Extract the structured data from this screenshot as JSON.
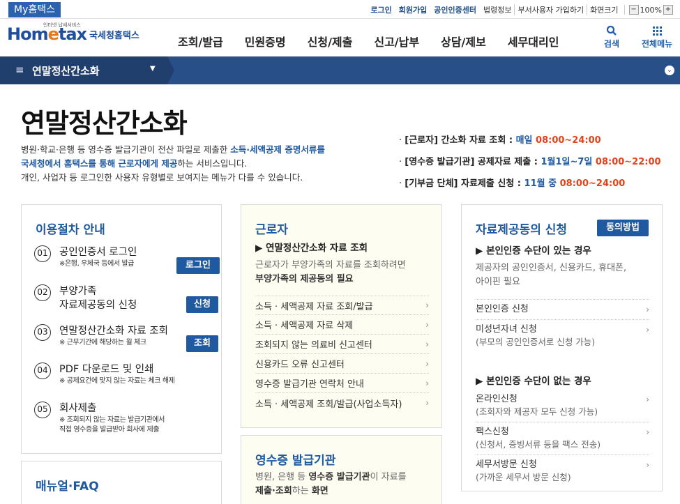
{
  "topbar": {
    "myhome": "My홈택스",
    "login": "로그인",
    "join": "회원가입",
    "cert": "공인인증센터",
    "law": "법령정보",
    "dept": "부서사용자 가입하기",
    "zoom_label": "화면크기",
    "zoom_minus": "−",
    "zoom_value": "100%",
    "zoom_plus": "+"
  },
  "header": {
    "logo_small": "인터넷 납세서비스",
    "logo_home": "Hom",
    "logo_e": "e",
    "logo_tax": "tax",
    "logo_text": "국세청홈택스",
    "nav": [
      "조회/발급",
      "민원증명",
      "신청/제출",
      "신고/납부",
      "상담/제보",
      "세무대리인"
    ],
    "search": "검색",
    "all_menu": "전체메뉴",
    "icons": {
      "search": "search-icon",
      "menu": "grid-menu-icon"
    }
  },
  "subbar": {
    "title": "연말정산간소화",
    "hamburger": "≡",
    "caret": "▼",
    "circle": "⌄"
  },
  "page": {
    "title": "연말정산간소화",
    "intro_1a": "병원·학교·은행 등 영수증 발급기관이 전산 파일로 제출한 ",
    "intro_1b": "소득·세액공제 증명서류를",
    "intro_2a": "국세청에서 홈택스를 통해 근로자에게 제공",
    "intro_2b": "하는 서비스입니다.",
    "intro_3": "개인, 사업자 등 로그인한 사용자 유형별로 보여지는 메뉴가 다를 수 있습니다.",
    "schedule": [
      {
        "label": "[근로자] 간소화 자료 조회 : ",
        "period": "매일 ",
        "time": "08:00~24:00"
      },
      {
        "label": "[영수증 발급기관] 공제자료 제출 : ",
        "period": "1월1일~7일 ",
        "time": "08:00~22:00"
      },
      {
        "label": "[기부금 단체] 자료제출 신청 : ",
        "period": "11월 중 ",
        "time": "08:00~24:00"
      }
    ]
  },
  "guide": {
    "title": "이용절차 안내",
    "steps": [
      {
        "num": "01",
        "title": "공인인증서 로그인",
        "note": "※은행, 우체국 등에서 발급",
        "button": "로그인"
      },
      {
        "num": "02",
        "title": "부양가족",
        "title2": "자료제공동의 신청",
        "button": "신청"
      },
      {
        "num": "03",
        "title": "연말정산간소화 자료 조회",
        "note": "※ 근무기간에 해당하는 월 체크",
        "button": "조회"
      },
      {
        "num": "04",
        "title": "PDF 다운로드 및 인쇄",
        "note": "※ 공제요건에 맞지 않는 자료는 체크 해제"
      },
      {
        "num": "05",
        "title": "회사제출",
        "note": "※ 조회되지 않는 자료는 발급기관에서",
        "note2": "직접 영수증을 발급받아 회사에 제출"
      }
    ]
  },
  "manual": {
    "title": "매뉴얼·FAQ"
  },
  "worker": {
    "title": "근로자",
    "sub": "▶ 연말정산간소화 자료 조회",
    "desc1": "근로자가 부양가족의 자료를 조회하려면",
    "desc2": "부양가족의 제공동의 필요",
    "items": [
      "소득 · 세액공제 자료 조회/발급",
      "소득 · 세액공제 자료 삭제",
      "조회되지 않는 의료비 신고센터",
      "신용카드 오류 신고센터",
      "영수증 발급기관 연락처 안내",
      "소득 · 세액공제 조회/발급(사업소득자)"
    ],
    "chevron": "›"
  },
  "issuer": {
    "title": "영수증 발급기관",
    "desc1a": "병원, 은행 등 ",
    "desc1b": "영수증 발급기관",
    "desc1c": "이 자료를",
    "desc2a": "제출·조회",
    "desc2b": "하는 ",
    "desc2c": "화면"
  },
  "consent": {
    "title": "자료제공동의 신청",
    "button": "동의방법",
    "sec1": "▶ 본인인증 수단이 있는 경우",
    "sec1_desc1": "제공자의 공인인증서, 신용카드, 휴대폰,",
    "sec1_desc2": "아이핀 필요",
    "sec1_items": [
      {
        "label": "본인인증 신청",
        "sub": ""
      },
      {
        "label": "미성년자녀 신청",
        "sub": "(부모의 공인인증서로 신청 가능)"
      }
    ],
    "sec2": "▶ 본인인증 수단이 없는 경우",
    "sec2_items": [
      {
        "label": "온라인신청",
        "sub": "(조회자와 제공자 모두 신청 가능)"
      },
      {
        "label": "팩스신청",
        "sub": "(신청서, 증빙서류 등을 팩스 전송)"
      },
      {
        "label": "세무서방문 신청",
        "sub": "(가까운 세무서 방문 신청)"
      }
    ],
    "chevron": "›"
  }
}
